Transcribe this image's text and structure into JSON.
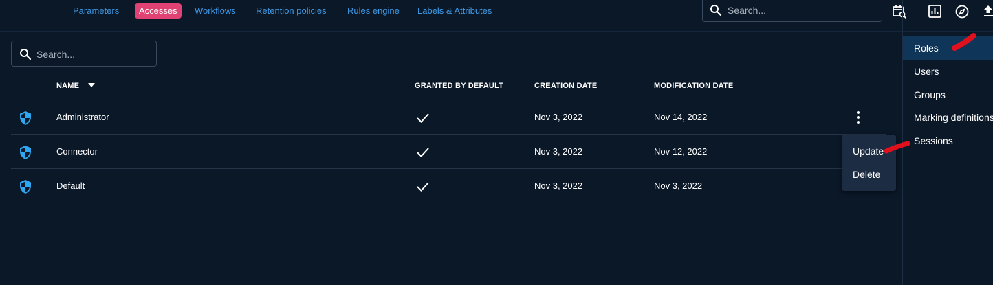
{
  "topnav": {
    "tabs": [
      {
        "label": "Parameters",
        "active": false
      },
      {
        "label": "Accesses",
        "active": true
      },
      {
        "label": "Workflows",
        "active": false
      },
      {
        "label": "Retention policies",
        "active": false
      },
      {
        "label": "Rules engine",
        "active": false
      },
      {
        "label": "Labels & Attributes",
        "active": false
      }
    ],
    "search_placeholder": "Search..."
  },
  "list": {
    "search_placeholder": "Search...",
    "columns": {
      "name": "NAME",
      "granted": "GRANTED BY DEFAULT",
      "created": "CREATION DATE",
      "modified": "MODIFICATION DATE"
    },
    "rows": [
      {
        "name": "Administrator",
        "granted": true,
        "created": "Nov 3, 2022",
        "modified": "Nov 14, 2022"
      },
      {
        "name": "Connector",
        "granted": true,
        "created": "Nov 3, 2022",
        "modified": "Nov 12, 2022"
      },
      {
        "name": "Default",
        "granted": true,
        "created": "Nov 3, 2022",
        "modified": "Nov 3, 2022"
      }
    ]
  },
  "context_menu": {
    "items": [
      "Update",
      "Delete"
    ]
  },
  "right_panel": {
    "items": [
      {
        "label": "Roles",
        "active": true
      },
      {
        "label": "Users",
        "active": false
      },
      {
        "label": "Groups",
        "active": false
      },
      {
        "label": "Marking definitions",
        "active": false
      },
      {
        "label": "Sessions",
        "active": false
      }
    ]
  },
  "colors": {
    "background": "#0b1828",
    "link": "#3d9ae8",
    "active_tab": "#e04273",
    "shield": "#2ea7f0",
    "annotation": "#e0101c"
  },
  "icons": {
    "search": "search-icon",
    "saved_search": "calendar-search-icon",
    "dashboard": "bar-chart-icon",
    "explore": "compass-icon",
    "upload": "upload-icon",
    "role": "shield-icon",
    "granted": "check-icon",
    "actions": "kebab-icon",
    "sort": "caret-down-icon"
  }
}
